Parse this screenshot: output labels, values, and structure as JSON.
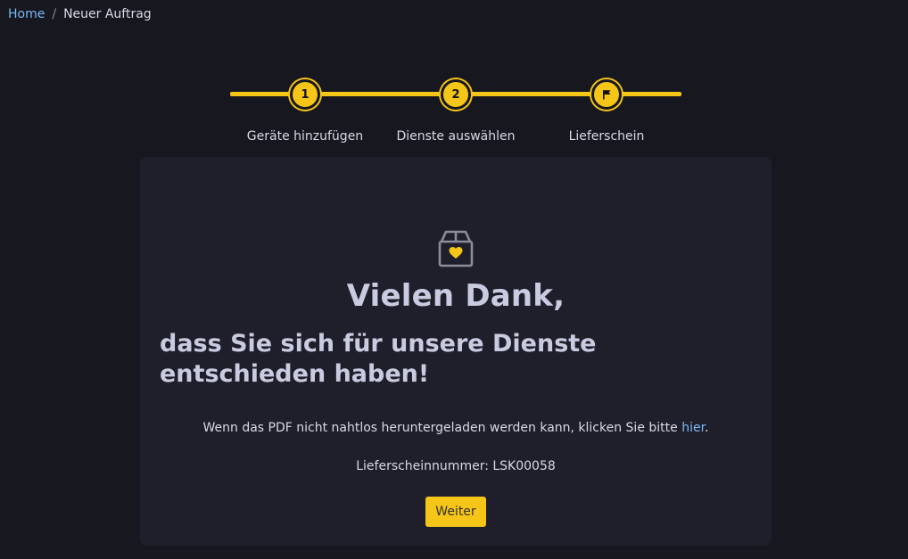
{
  "breadcrumb": {
    "home": "Home",
    "separator": "/",
    "current": "Neuer Auftrag"
  },
  "stepper": {
    "steps": [
      {
        "number": "1",
        "label": "Geräte hinzufügen"
      },
      {
        "number": "2",
        "label": "Dienste auswählen"
      },
      {
        "icon": "flag-icon",
        "label": "Lieferschein"
      }
    ],
    "accent_color": "#f5c518"
  },
  "confirmation": {
    "icon": "box-heart-icon",
    "title": "Vielen Dank,",
    "subtitle": "dass Sie sich für unsere Dienste entschieden haben!",
    "note_prefix": "Wenn das PDF nicht nahtlos heruntergeladen werden kann, klicken Sie bitte ",
    "note_link": "hier",
    "note_suffix": ".",
    "delivery_number_label": "Lieferscheinnummer:",
    "delivery_number": "LSK00058",
    "continue_button": "Weiter"
  }
}
